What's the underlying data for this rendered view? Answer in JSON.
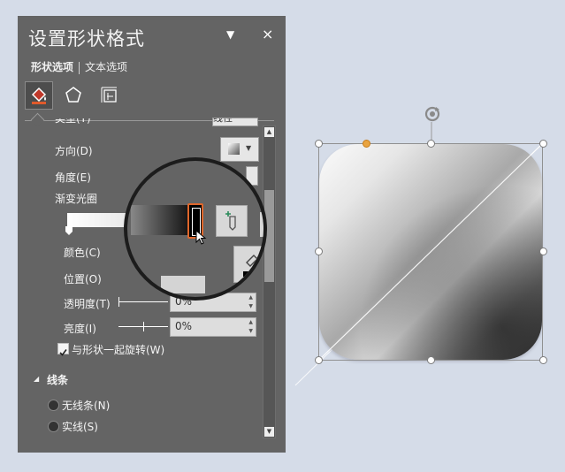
{
  "pane": {
    "title": "设置形状格式",
    "dropdown_glyph": "▼",
    "close_glyph": "×",
    "tabs": [
      {
        "label": "形状选项",
        "active": true
      },
      {
        "label": "文本选项",
        "active": false
      }
    ],
    "category_icons": [
      "paint-bucket-icon",
      "pentagon-icon",
      "layout-size-icon"
    ],
    "cut_off_top": {
      "label": "类型(Y)",
      "value": "线性"
    },
    "fields": {
      "direction_label": "方向(D)",
      "angle_label": "角度(E)",
      "gradient_stops_label": "渐变光圈",
      "color_label": "颜色(C)",
      "position_label": "位置(O)",
      "transparency_label": "透明度(T)",
      "transparency_value": "0%",
      "brightness_label": "亮度(I)",
      "brightness_value": "0%",
      "rotate_with_shape_label": "与形状一起旋转(W)",
      "rotate_with_shape_checked": true
    },
    "line_section": {
      "title": "线条",
      "options": [
        {
          "label": "无线条(N)",
          "selected": false
        },
        {
          "label": "实线(S)",
          "selected": false
        }
      ]
    },
    "colors": {
      "pane_bg": "#646464",
      "stop_highlight": "#e0672b"
    }
  },
  "canvas": {
    "background": "#d5dce8",
    "shape": "rounded-rectangle with linear gradient fill",
    "adjust_handle_color": "#e9a441"
  }
}
